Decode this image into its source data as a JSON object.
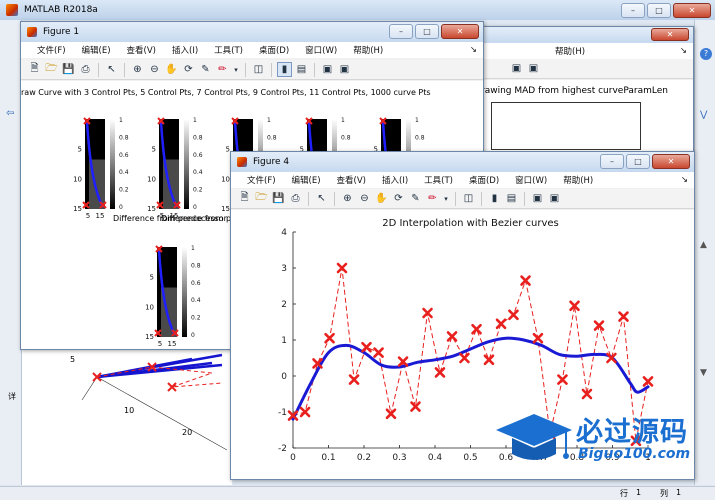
{
  "desktop": {
    "title": "MATLAB R2018a",
    "status_row_label": "行",
    "status_row_value": "1",
    "status_col_label": "列",
    "status_col_value": "1",
    "side_label": "详"
  },
  "fig1": {
    "title": "Figure 1",
    "menus": [
      "文件(F)",
      "编辑(E)",
      "查看(V)",
      "插入(I)",
      "工具(T)",
      "桌面(D)",
      "窗口(W)",
      "帮助(H)"
    ],
    "subtitle_row1": "raw Curve with 3 Control Pts, 5 Control Pts, 7 Control Pts, 9 Control Pts, 11 Control Pts, 1000 curve Pts",
    "subtitle_row2": "Difference from predecessor",
    "yticks": [
      "5",
      "10",
      "15"
    ],
    "xticks": [
      "5",
      "15"
    ],
    "cbar": [
      "1",
      "0.8",
      "0.6",
      "0.4",
      "0.2",
      "0"
    ]
  },
  "fig2": {
    "menus": [
      "帮助(H)"
    ],
    "title": "rawing MAD from highest curveParamLen"
  },
  "fig4": {
    "title": "Figure 4",
    "menus": [
      "文件(F)",
      "编辑(E)",
      "查看(V)",
      "插入(I)",
      "工具(T)",
      "桌面(D)",
      "窗口(W)",
      "帮助(H)"
    ]
  },
  "background_axes": {
    "ylabel_tick": "5",
    "xticks": [
      "10",
      "20"
    ]
  },
  "watermark": {
    "cn": "必过源码",
    "en": "Biguo100.com"
  },
  "chart_data": {
    "type": "line",
    "title": "2D Interpolation with Bezier curves",
    "xlim": [
      0,
      1
    ],
    "ylim": [
      -2,
      4
    ],
    "xticks": [
      "0",
      "0.1",
      "0.2",
      "0.3",
      "0.4",
      "0.5",
      "0.6",
      "0.7",
      "0.8",
      "0.9",
      "1"
    ],
    "yticks": [
      "-2",
      "-1",
      "0",
      "1",
      "2",
      "3",
      "4"
    ],
    "grid": false,
    "series": [
      {
        "style": "dashed-red-x",
        "color": "#e8201e",
        "x": [
          0.0,
          0.034,
          0.069,
          0.103,
          0.138,
          0.172,
          0.207,
          0.241,
          0.276,
          0.31,
          0.345,
          0.379,
          0.414,
          0.448,
          0.483,
          0.517,
          0.552,
          0.586,
          0.621,
          0.655,
          0.69,
          0.724,
          0.759,
          0.793,
          0.828,
          0.862,
          0.897,
          0.931,
          0.966,
          1.0
        ],
        "y": [
          -1.1,
          -1.0,
          0.35,
          1.05,
          3.0,
          -0.1,
          0.8,
          0.65,
          -1.05,
          0.4,
          -0.85,
          1.75,
          0.1,
          1.1,
          0.5,
          1.3,
          0.45,
          1.45,
          1.7,
          2.65,
          1.05,
          -1.6,
          -0.1,
          1.95,
          -0.5,
          1.4,
          0.5,
          1.65,
          -1.8,
          -0.15
        ]
      },
      {
        "style": "solid-blue",
        "color": "#1a1ad4",
        "x": [
          0.0,
          0.05,
          0.1,
          0.15,
          0.2,
          0.25,
          0.3,
          0.35,
          0.4,
          0.45,
          0.5,
          0.55,
          0.6,
          0.65,
          0.7,
          0.75,
          0.8,
          0.85,
          0.9,
          0.95,
          0.97,
          1.0
        ],
        "y": [
          -1.2,
          -0.2,
          0.65,
          0.85,
          0.65,
          0.3,
          0.25,
          0.38,
          0.45,
          0.55,
          0.75,
          0.95,
          1.05,
          1.0,
          0.85,
          0.6,
          0.55,
          0.6,
          0.5,
          -0.2,
          -0.45,
          -0.3
        ]
      }
    ]
  }
}
